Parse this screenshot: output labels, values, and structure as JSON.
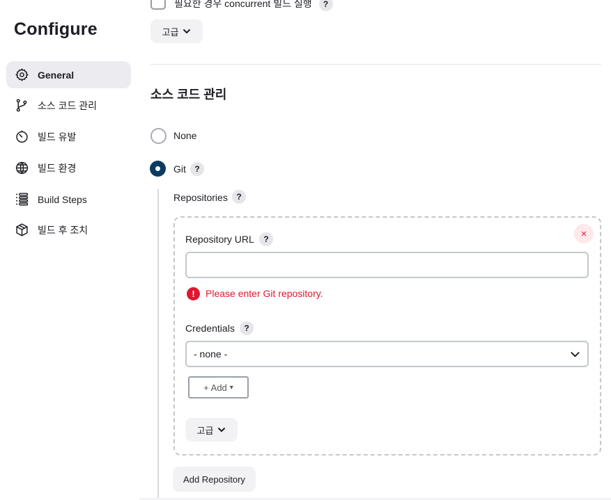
{
  "sidebar": {
    "title": "Configure",
    "items": [
      {
        "label": "General",
        "icon": "gear-icon"
      },
      {
        "label": "소스 코드 관리",
        "icon": "branch-icon"
      },
      {
        "label": "빌드 유발",
        "icon": "timer-icon"
      },
      {
        "label": "빌드 환경",
        "icon": "globe-icon"
      },
      {
        "label": "Build Steps",
        "icon": "list-icon"
      },
      {
        "label": "빌드 후 조치",
        "icon": "package-icon"
      }
    ]
  },
  "general": {
    "concurrent_label": "필요한 경우 concurrent 빌드 실행",
    "help": "?",
    "advanced_label": "고급"
  },
  "scm": {
    "title": "소스 코드 관리",
    "options": [
      {
        "label": "None",
        "selected": false
      },
      {
        "label": "Git",
        "selected": true
      }
    ],
    "help": "?",
    "repositories_label": "Repositories",
    "repository": {
      "close_label": "×",
      "url_label": "Repository URL",
      "url_value": "",
      "url_placeholder": "",
      "error_icon": "!",
      "error_text": "Please enter Git repository.",
      "credentials_label": "Credentials",
      "credentials_value": "- none -",
      "add_label": "+ Add",
      "add_caret": "▾",
      "advanced_label": "고급"
    },
    "add_repository_label": "Add Repository"
  },
  "colors": {
    "accent": "#0b3a5f",
    "error": "#e0182f",
    "nav_active_bg": "#ebebf0"
  }
}
